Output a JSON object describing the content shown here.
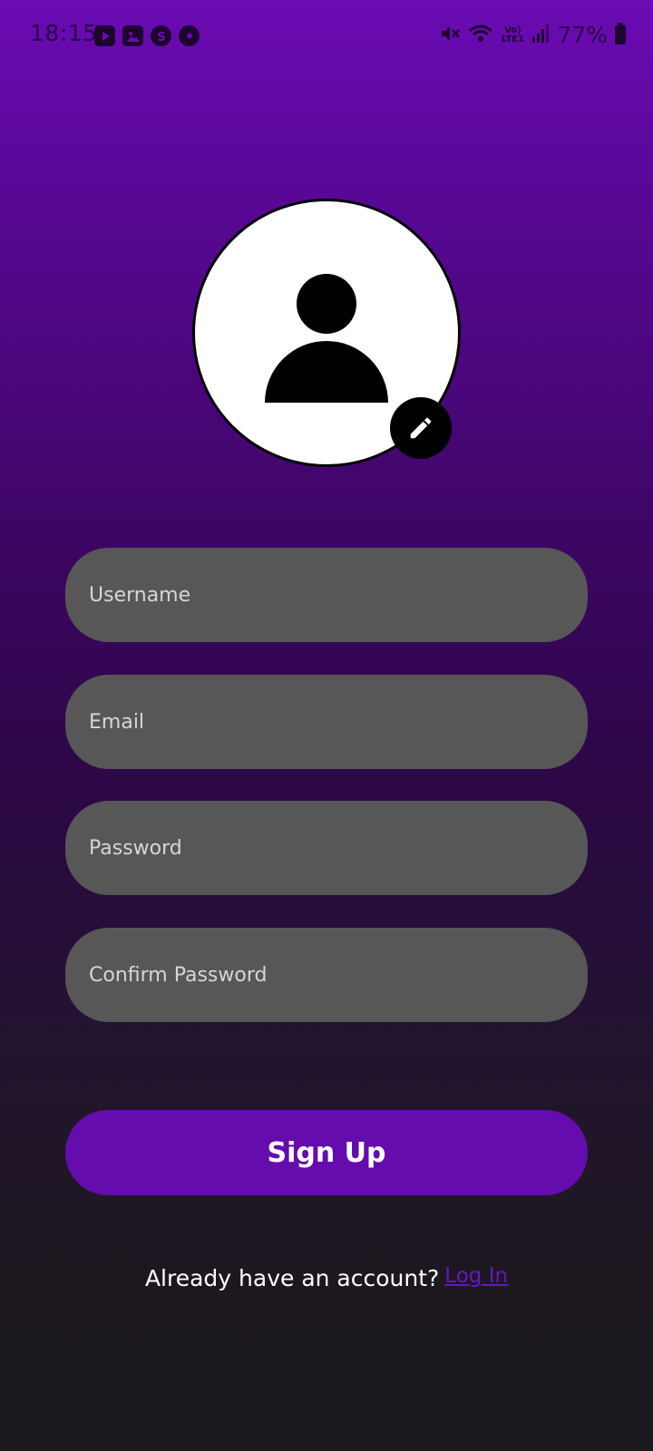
{
  "status_bar": {
    "time": "18:15",
    "battery_percent": "77%",
    "network_label": "Vo) LTE1",
    "left_icons": [
      "youtube-icon",
      "gallery-icon",
      "skype-icon",
      "soccer-ball-icon"
    ],
    "right_icons": [
      "mute-icon",
      "wifi-icon",
      "volte-icon",
      "signal-icon",
      "battery-icon"
    ]
  },
  "profile": {
    "avatar_icon": "person-icon",
    "edit_icon": "pencil-icon"
  },
  "form": {
    "username_placeholder": "Username",
    "email_placeholder": "Email",
    "password_placeholder": "Password",
    "confirm_password_placeholder": "Confirm Password",
    "username_value": "",
    "email_value": "",
    "password_value": "",
    "confirm_password_value": ""
  },
  "actions": {
    "signup_label": "Sign Up"
  },
  "footer": {
    "prompt": "Already have an account?",
    "login_link": "Log In"
  },
  "colors": {
    "accent": "#650cae",
    "link": "#6a14c4",
    "field_bg": "#575757",
    "gradient_top": "#6a0bb4",
    "gradient_bottom": "#1c1a1e"
  }
}
